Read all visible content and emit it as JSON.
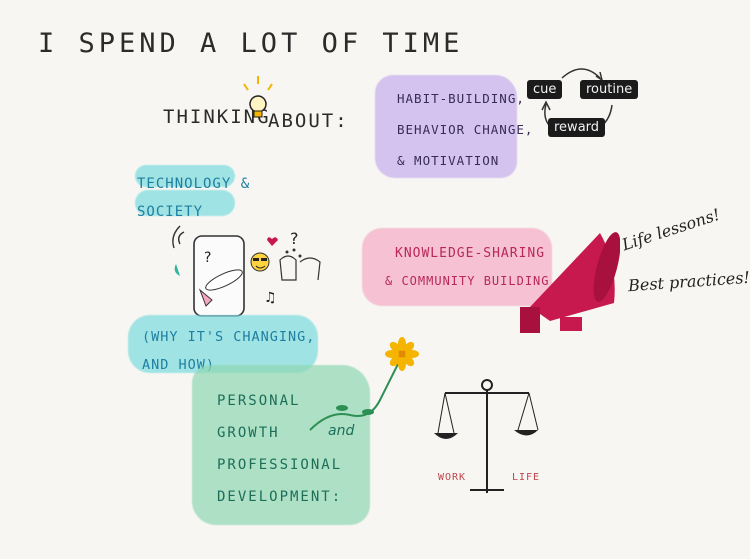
{
  "title": "I spend a lot of time",
  "subtitle": {
    "left": "Thinking",
    "right": "about:"
  },
  "habit": {
    "lines": [
      "Habit-building,",
      "behavior change,",
      "& motivation"
    ],
    "loop": {
      "cue": "cue",
      "routine": "routine",
      "reward": "reward"
    }
  },
  "technology": {
    "title_lines": [
      "Technology &",
      "society"
    ],
    "why_lines": [
      "(why it's changing,",
      "and how)"
    ]
  },
  "knowledge": {
    "line1": "Knowledge-sharing",
    "line2": "& community building",
    "notes": [
      "Life lessons!",
      "Best practices!"
    ]
  },
  "growth": {
    "lines": [
      "Personal",
      "growth",
      "Professional",
      "Development:"
    ],
    "and": "and"
  },
  "balance": {
    "left_label": "Work",
    "right_label": "Life"
  },
  "colors": {
    "purple": "#c9b3ee",
    "cyan": "#7fdde0",
    "pink": "#f6a6c1",
    "green": "#8ed7b3",
    "megaphone": "#c8194f",
    "flower": "#f4b400"
  },
  "icons": [
    "lightbulb-icon",
    "phone-icon",
    "emoji-icon",
    "heart-icon",
    "megaphone-icon",
    "flower-icon",
    "scale-icon",
    "cycle-arrows-icon"
  ]
}
